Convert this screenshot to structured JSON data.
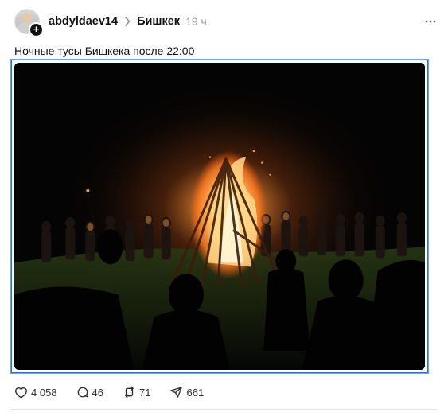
{
  "post": {
    "author": "abdyldaev14",
    "community": "Бишкек",
    "time": "19 ч.",
    "caption": "Ночные тусы Бишкека после 22:00"
  },
  "stats": {
    "likes": "4 058",
    "replies": "46",
    "reposts": "71",
    "shares": "661"
  },
  "icons": {
    "avatar_badge": "plus-icon",
    "separator": "chevron-right-icon",
    "menu": "more-horizontal-icon",
    "like": "heart-icon",
    "reply": "comment-icon",
    "repost": "repost-icon",
    "share": "send-icon"
  },
  "colors": {
    "selection_border": "#1a73e8",
    "text_primary": "#101010",
    "text_secondary": "#9a9a9a"
  }
}
